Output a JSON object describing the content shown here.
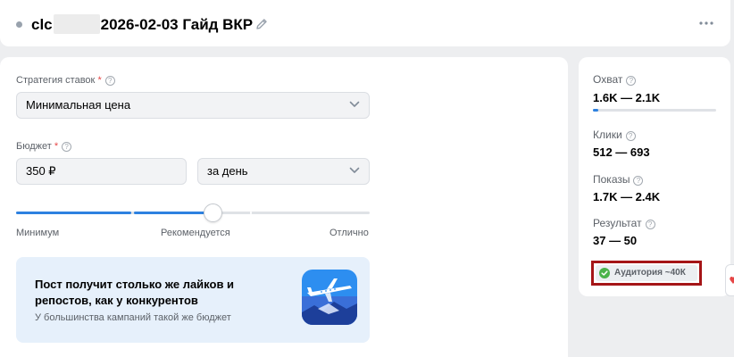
{
  "header": {
    "title_prefix": "clc",
    "title_suffix": "2026-02-03 Гайд ВКР"
  },
  "bid_strategy": {
    "label": "Стратегия ставок",
    "required_mark": "*",
    "value": "Минимальная цена"
  },
  "budget": {
    "label": "Бюджет",
    "required_mark": "*",
    "amount": "350 ₽",
    "period": "за день"
  },
  "budget_slider": {
    "level_percent": 55,
    "min_label": "Минимум",
    "recommended_label": "Рекомендуется",
    "max_label": "Отлично"
  },
  "hint": {
    "title": "Пост получит столько же лайков и репостов, как у конкурентов",
    "subtitle": "У большинства кампаний такой же бюджет"
  },
  "forecast": {
    "reach": {
      "label": "Охват",
      "value": "1.6K — 2.1K",
      "bar_percent": 4
    },
    "clicks": {
      "label": "Клики",
      "value": "512 — 693"
    },
    "impressions": {
      "label": "Показы",
      "value": "1.7K — 2.4K"
    },
    "result": {
      "label": "Результат",
      "value": "37 — 50"
    },
    "audience_badge": "Аудитория ~40К"
  },
  "colors": {
    "accent": "#2d81e0",
    "required": "#e64646",
    "highlight_border": "#a51517",
    "success": "#4bb34b"
  }
}
